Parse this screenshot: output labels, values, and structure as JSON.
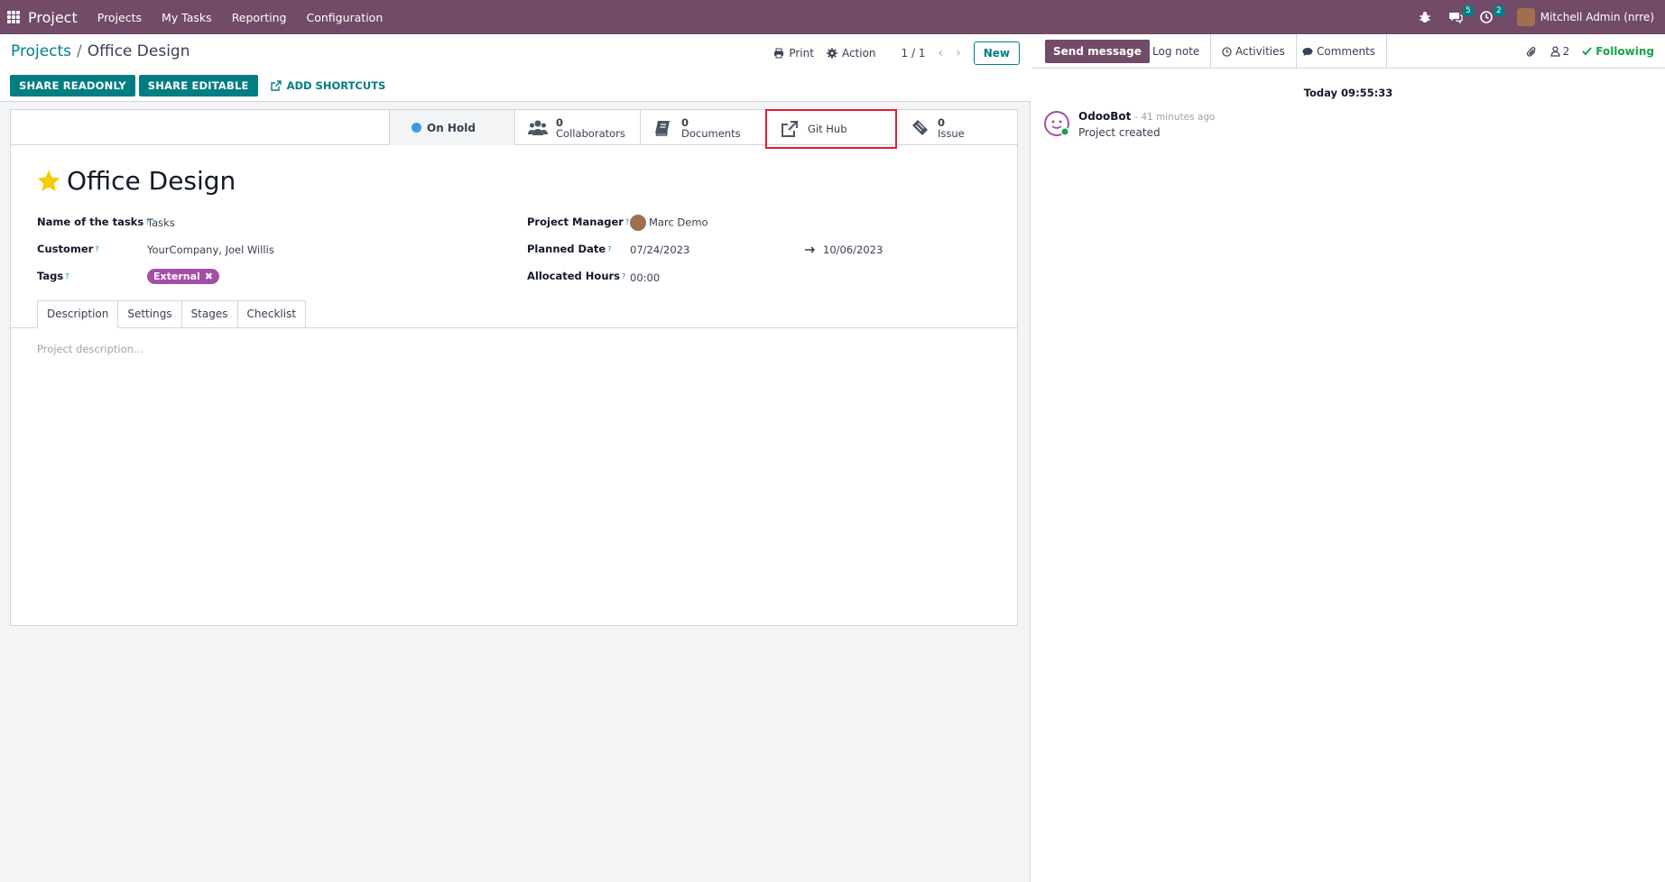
{
  "navbar": {
    "brand": "Project",
    "menu": [
      "Projects",
      "My Tasks",
      "Reporting",
      "Configuration"
    ],
    "messages_count": "5",
    "activities_count": "2",
    "user": "Mitchell Admin (nrre)"
  },
  "breadcrumb": {
    "parent": "Projects",
    "separator": "/",
    "current": "Office Design"
  },
  "control": {
    "print": "Print",
    "action": "Action",
    "pager": "1 / 1",
    "new": "New",
    "share_readonly": "SHARE READONLY",
    "share_editable": "SHARE EDITABLE",
    "add_shortcuts": "ADD SHORTCUTS"
  },
  "stats": {
    "status": "On Hold",
    "collaborators_count": "0",
    "collaborators_label": "Collaborators",
    "documents_count": "0",
    "documents_label": "Documents",
    "github_label": "Git Hub",
    "issue_count": "0",
    "issue_label": "Issue"
  },
  "project": {
    "title": "Office Design",
    "tasks_label": "Name of the tasks",
    "tasks_value": "Tasks",
    "customer_label": "Customer",
    "customer_value": "YourCompany, Joel Willis",
    "tags_label": "Tags",
    "tag_value": "External",
    "manager_label": "Project Manager",
    "manager_value": "Marc Demo",
    "planned_label": "Planned Date",
    "planned_start": "07/24/2023",
    "planned_end": "10/06/2023",
    "hours_label": "Allocated Hours",
    "hours_value": "00:00",
    "help_mark": "?"
  },
  "tabs": [
    "Description",
    "Settings",
    "Stages",
    "Checklist"
  ],
  "description_placeholder": "Project description...",
  "chatter": {
    "send_message": "Send message",
    "log_note": "Log note",
    "activities": "Activities",
    "comments": "Comments",
    "followers_count": "2",
    "following": "Following",
    "date_separator": "Today 09:55:33",
    "message": {
      "author": "OdooBot",
      "time": "- 41 minutes ago",
      "body": "Project created"
    }
  },
  "colors": {
    "brand": "#714B67",
    "primary": "#017E84",
    "tag": "#a54ea8",
    "highlight": "#e11d2f"
  }
}
